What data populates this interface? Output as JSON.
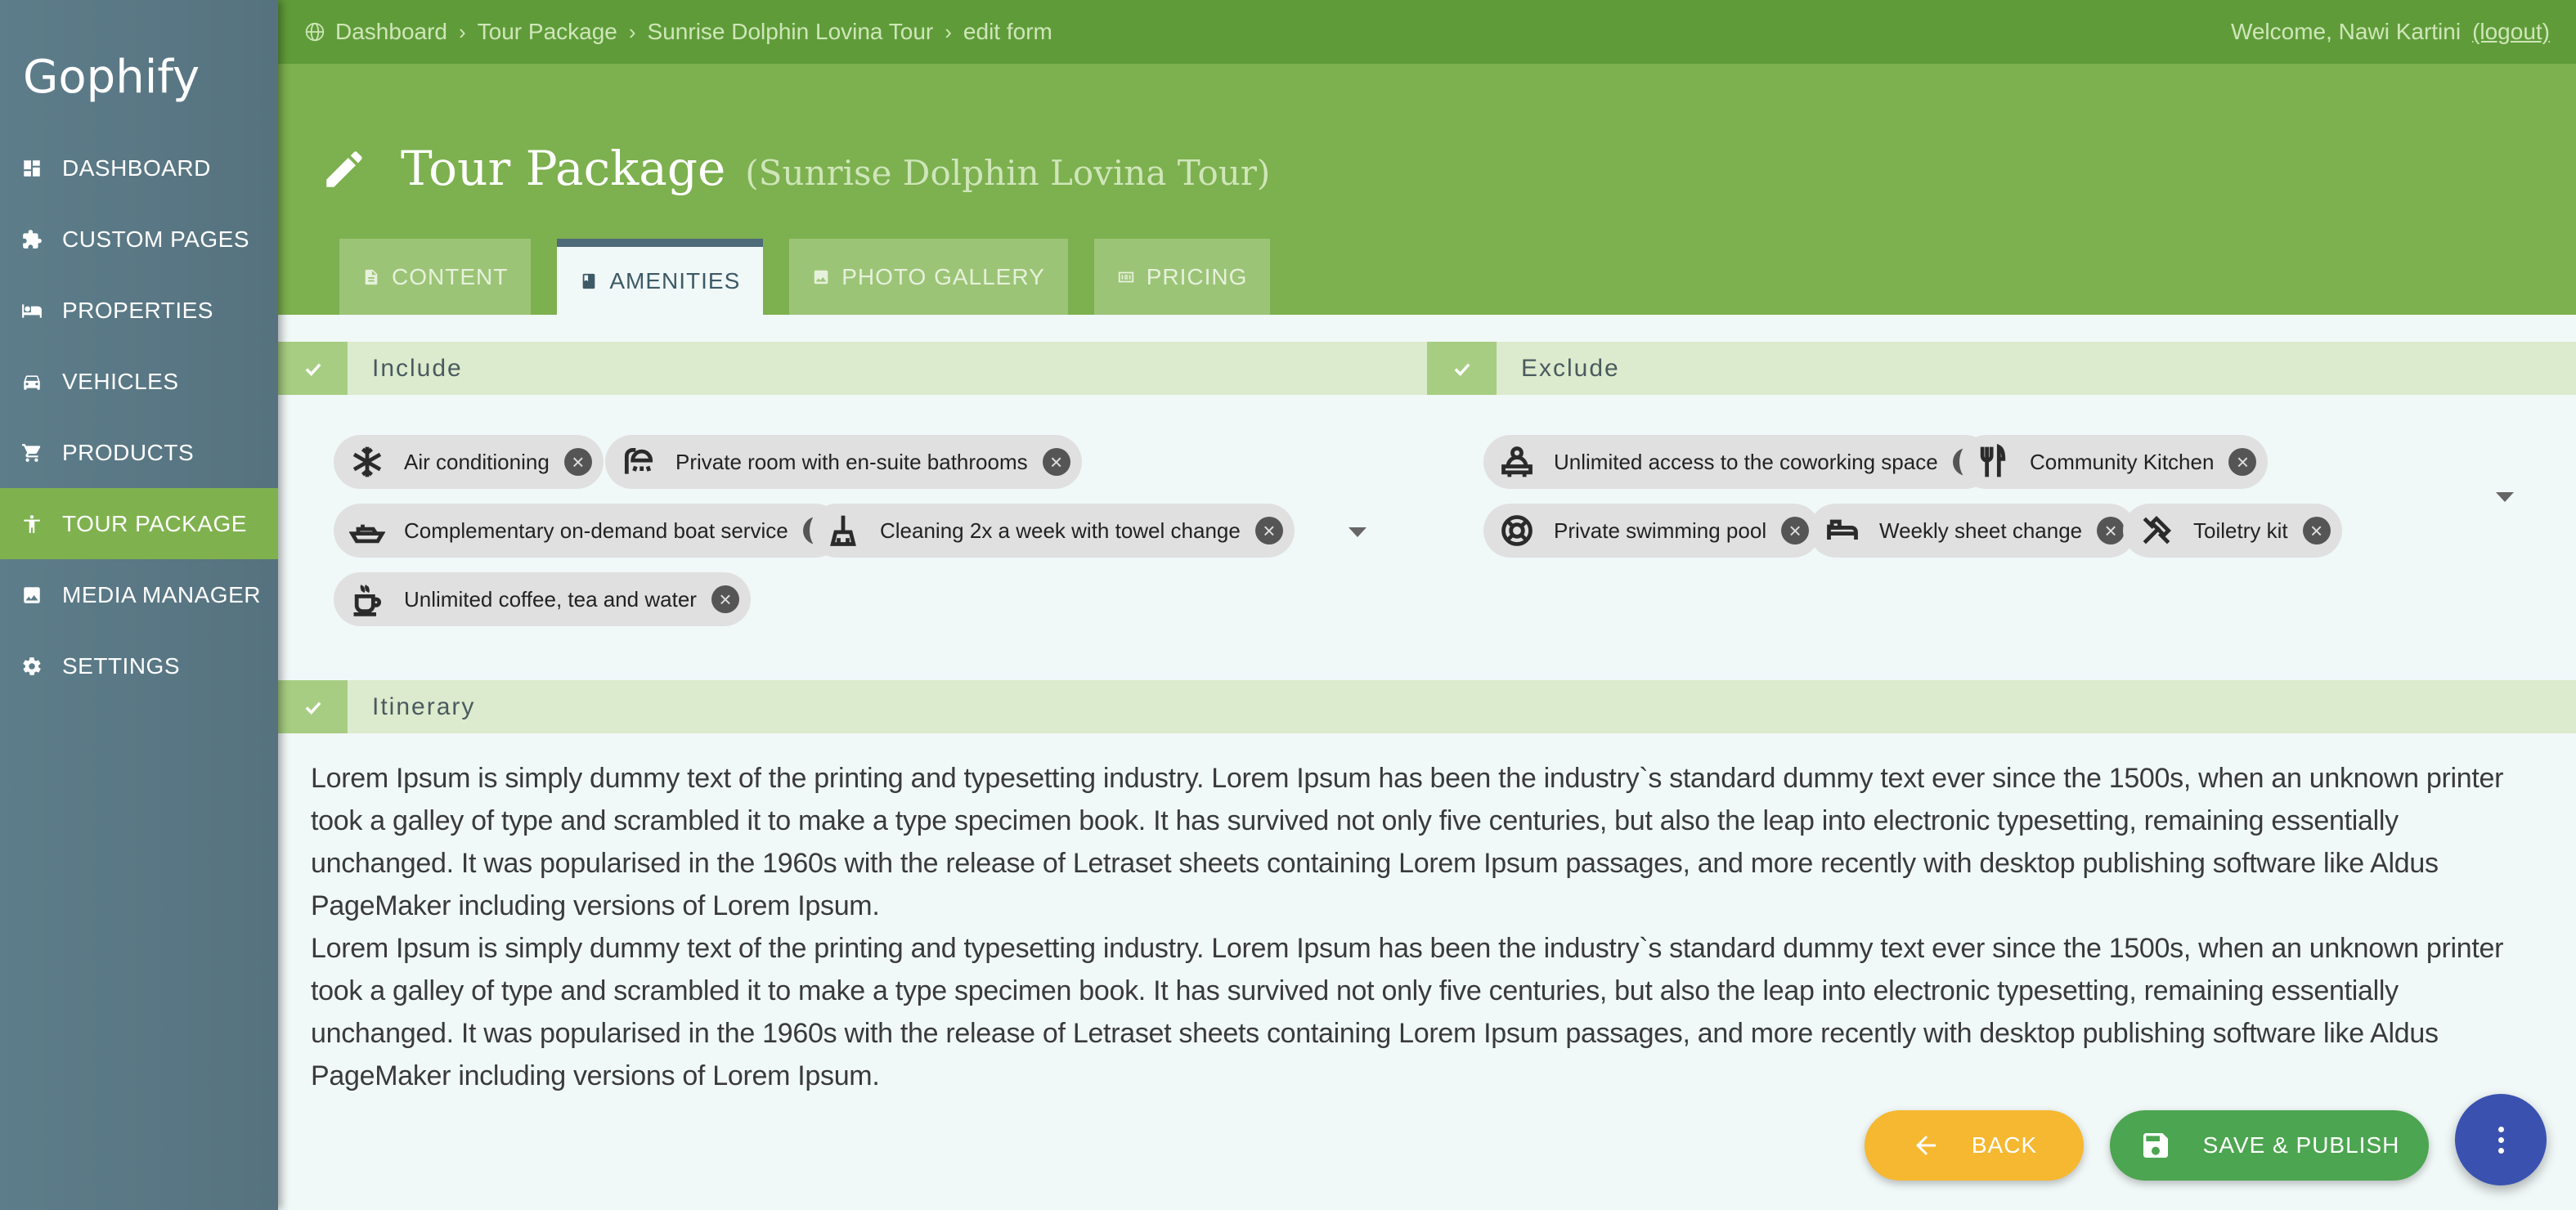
{
  "app": {
    "brand": "Gophify"
  },
  "sidebar": {
    "items": [
      {
        "label": "DASHBOARD",
        "icon": "dashboard-icon"
      },
      {
        "label": "CUSTOM PAGES",
        "icon": "puzzle-icon"
      },
      {
        "label": "PROPERTIES",
        "icon": "bed-icon"
      },
      {
        "label": "VEHICLES",
        "icon": "car-icon"
      },
      {
        "label": "PRODUCTS",
        "icon": "cart-icon"
      },
      {
        "label": "TOUR PACKAGE",
        "icon": "person-icon",
        "active": true
      },
      {
        "label": "MEDIA MANAGER",
        "icon": "image-icon"
      },
      {
        "label": "SETTINGS",
        "icon": "gear-icon"
      }
    ]
  },
  "topbar": {
    "breadcrumb": [
      "Dashboard",
      "Tour Package",
      "Sunrise Dolphin Lovina Tour",
      "edit form"
    ],
    "welcome": "Welcome, Nawi Kartini",
    "logout": "(logout)"
  },
  "header": {
    "title": "Tour Package",
    "subtitle": "(Sunrise Dolphin Lovina Tour)"
  },
  "tabs": [
    {
      "label": "CONTENT",
      "icon": "document-icon"
    },
    {
      "label": "AMENITIES",
      "icon": "book-icon",
      "active": true
    },
    {
      "label": "PHOTO GALLERY",
      "icon": "image-icon"
    },
    {
      "label": "PRICING",
      "icon": "money-icon"
    }
  ],
  "include": {
    "title": "Include",
    "chips": [
      {
        "label": "Air conditioning",
        "icon": "snowflake-icon"
      },
      {
        "label": "Private room with en-suite bathrooms",
        "icon": "shower-icon"
      },
      {
        "label": "Complementary on-demand boat service",
        "icon": "boat-icon"
      },
      {
        "label": "Cleaning 2x a week with towel change",
        "icon": "broom-icon"
      },
      {
        "label": "Unlimited coffee, tea and water",
        "icon": "coffee-icon"
      }
    ]
  },
  "exclude": {
    "title": "Exclude",
    "chips": [
      {
        "label": "Unlimited access to the coworking space",
        "icon": "desk-worker-icon"
      },
      {
        "label": "Community Kitchen",
        "icon": "cutlery-icon"
      },
      {
        "label": "Private swimming pool",
        "icon": "lifebuoy-icon"
      },
      {
        "label": "Weekly sheet change",
        "icon": "bed-icon"
      },
      {
        "label": "Toiletry kit",
        "icon": "toiletry-icon"
      }
    ]
  },
  "itinerary": {
    "title": "Itinerary",
    "paragraphs": [
      "Lorem Ipsum is simply dummy text of the printing and typesetting industry. Lorem Ipsum has been the industry`s standard dummy text ever since the 1500s, when an unknown printer took a galley of type and scrambled it to make a type specimen book. It has survived not only five centuries, but also the leap into electronic typesetting, remaining essentially unchanged. It was popularised in the 1960s with the release of Letraset sheets containing Lorem Ipsum passages, and more recently with desktop publishing software like Aldus PageMaker including versions of Lorem Ipsum.",
      "Lorem Ipsum is simply dummy text of the printing and typesetting industry. Lorem Ipsum has been the industry`s standard dummy text ever since the 1500s, when an unknown printer took a galley of type and scrambled it to make a type specimen book. It has survived not only five centuries, but also the leap into electronic typesetting, remaining essentially unchanged. It was popularised in the 1960s with the release of Letraset sheets containing Lorem Ipsum passages, and more recently with desktop publishing software like Aldus PageMaker including versions of Lorem Ipsum."
    ]
  },
  "actions": {
    "back_label": "BACK",
    "save_label": "SAVE & PUBLISH"
  },
  "colors": {
    "sidebar": "#5a7885",
    "accent_green": "#7db04f",
    "active_nav": "#7fb24e",
    "back_button": "#f6b830",
    "save_button": "#4ca550",
    "fab": "#3a51b0"
  }
}
